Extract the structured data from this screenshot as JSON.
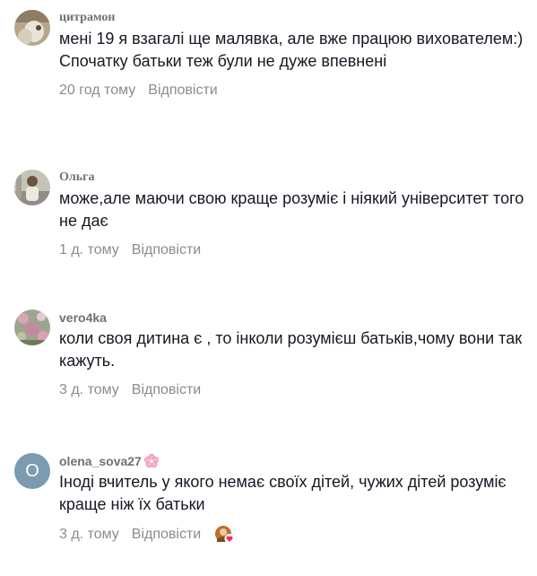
{
  "comments": [
    {
      "username": "цитрамон",
      "text": "мені 19 я взагалі ще малявка, але вже працюю вихователем:) Спочатку батьки теж були не дуже впевнені",
      "time": "20 год тому",
      "reply": "Відповісти"
    },
    {
      "username": "Ольга",
      "text": "може,але маючи свою краще розуміє і ніякий університет того не дає",
      "time": "1 д. тому",
      "reply": "Відповісти"
    },
    {
      "username": "vero4ka",
      "text": "коли своя дитина є , то інколи розумієш батьків,чому вони так кажуть.",
      "time": "3 д. тому",
      "reply": "Відповісти"
    },
    {
      "username": "olena_sova27",
      "avatar_letter": "O",
      "text": "Іноді вчитель у якого немає своїх дітей, чужих дітей розуміє краще ніж їх батьки",
      "time": "3 д. тому",
      "reply": "Відповісти"
    }
  ],
  "colors": {
    "username": "#6f7079",
    "text": "#161823",
    "meta": "#8a8b91",
    "avatar_letter_bg": "#7a9bb0",
    "like_heart": "#fe2c55"
  },
  "icons": [
    "flower-emoji-icon",
    "creator-liked-icon",
    "heart-icon"
  ]
}
